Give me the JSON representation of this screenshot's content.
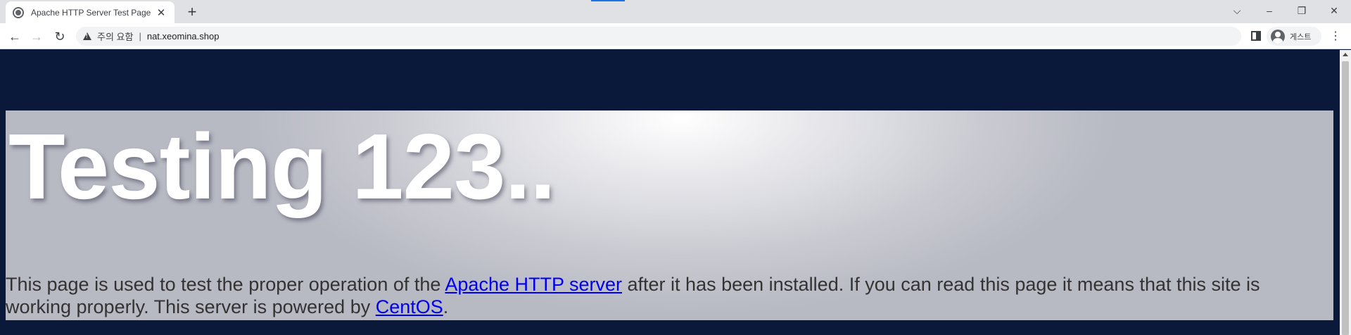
{
  "browser": {
    "tab": {
      "title": "Apache HTTP Server Test Page powered by CentOS",
      "close_glyph": "✕",
      "favicon": "globe-icon"
    },
    "new_tab_glyph": "+",
    "window_controls": {
      "dropdown": "⌵",
      "minimize": "–",
      "restore": "❐",
      "close": "✕"
    },
    "nav": {
      "back": "←",
      "forward": "→",
      "reload": "↻"
    },
    "omnibox": {
      "security_icon": "warning-icon",
      "security_label": "주의 요함",
      "separator": "|",
      "url": "nat.xeomina.shop"
    },
    "profile": {
      "label": "게스트",
      "icon": "avatar-icon"
    },
    "menu_glyph": "⋮"
  },
  "page": {
    "heading": "Testing 123..",
    "lead_text_1": "This page is used to test the proper operation of the ",
    "link_apache": "Apache HTTP server",
    "lead_text_2": " after it has been installed. If you can read this page it means that this site is working properly. This server is powered by ",
    "link_centos": "CentOS",
    "lead_text_3": "."
  },
  "colors": {
    "page_background": "#0a1939",
    "heading": "#ffffff",
    "body_text": "#333333",
    "link": "#0000ee"
  }
}
